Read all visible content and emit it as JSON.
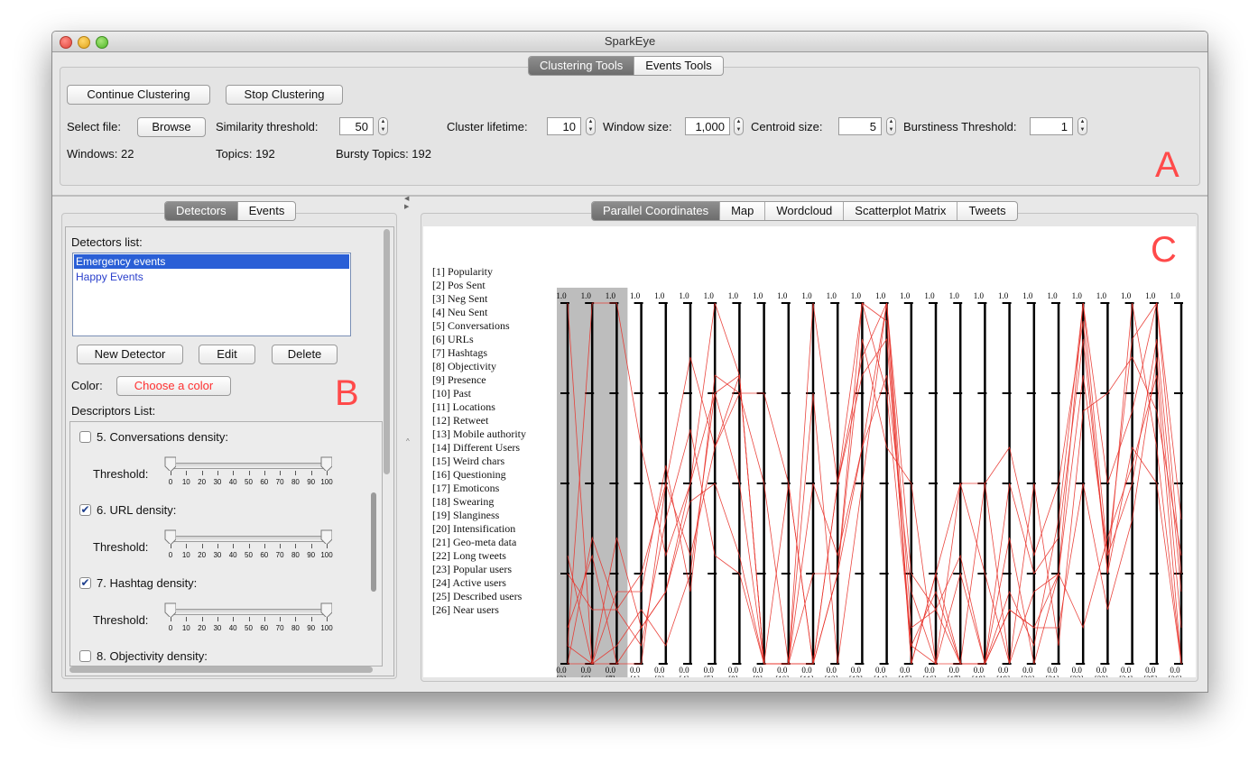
{
  "window": {
    "title": "SparkEye"
  },
  "top_tabs": [
    "Clustering Tools",
    "Events Tools"
  ],
  "clustering": {
    "continue_label": "Continue Clustering",
    "stop_label": "Stop Clustering",
    "select_file_label": "Select file:",
    "browse_label": "Browse",
    "similarity_label": "Similarity threshold:",
    "similarity_value": "50",
    "cluster_lifetime_label": "Cluster lifetime:",
    "cluster_lifetime_value": "10",
    "window_size_label": "Window size:",
    "window_size_value": "1,000",
    "centroid_size_label": "Centroid size:",
    "centroid_size_value": "5",
    "burstiness_label": "Burstiness Threshold:",
    "burstiness_value": "1",
    "windows_text": "Windows: 22",
    "topics_text": "Topics: 192",
    "bursty_text": "Bursty Topics: 192"
  },
  "annotations": {
    "a": "A",
    "b": "B",
    "c": "C"
  },
  "left_tabs": [
    "Detectors",
    "Events"
  ],
  "detectors": {
    "list_label": "Detectors list:",
    "items": [
      "Emergency events",
      "Happy Events"
    ],
    "new_label": "New Detector",
    "edit_label": "Edit",
    "delete_label": "Delete",
    "color_label": "Color:",
    "choose_color_label": "Choose a color",
    "descriptors_label": "Descriptors List:",
    "threshold_label": "Threshold:",
    "scale_ticks": [
      "0",
      "10",
      "20",
      "30",
      "40",
      "50",
      "60",
      "70",
      "80",
      "90",
      "100"
    ],
    "descriptors": [
      {
        "label": "5. Conversations density:",
        "checked": false
      },
      {
        "label": "6. URL density:",
        "checked": true
      },
      {
        "label": "7. Hashtag density:",
        "checked": true
      },
      {
        "label": "8. Objectivity density:",
        "checked": false
      }
    ]
  },
  "right_tabs": [
    "Parallel Coordinates",
    "Map",
    "Wordcloud",
    "Scatterplot Matrix",
    "Tweets"
  ],
  "legend": [
    "[1] Popularity",
    "[2] Pos Sent",
    "[3] Neg Sent",
    "[4] Neu Sent",
    "[5] Conversations",
    "[6] URLs",
    "[7] Hashtags",
    "[8] Objectivity",
    "[9] Presence",
    "[10] Past",
    "[11] Locations",
    "[12] Retweet",
    "[13] Mobile authority",
    "[14] Different Users",
    "[15] Weird chars",
    "[16] Questioning",
    "[17] Emoticons",
    "[18] Swearing",
    "[19] Slanginess",
    "[20] Intensification",
    "[21] Geo-meta data",
    "[22] Long tweets",
    "[23] Popular users",
    "[24] Active users",
    "[25] Described users",
    "[26] Near users"
  ],
  "colors": {
    "line": "#e8322a",
    "accent_text": "#ff3030",
    "selection": "#2a5fd6",
    "highlight_band": "#bdbdbd"
  },
  "chart_data": {
    "type": "parallel-coordinates",
    "axis_order": [
      "[3]",
      "[6]",
      "[7]",
      "[1]",
      "[2]",
      "[4]",
      "[5]",
      "[8]",
      "[9]",
      "[10]",
      "[11]",
      "[12]",
      "[13]",
      "[14]",
      "[15]",
      "[16]",
      "[17]",
      "[18]",
      "[19]",
      "[20]",
      "[21]",
      "[22]",
      "[23]",
      "[24]",
      "[25]",
      "[26]"
    ],
    "highlighted_axes": [
      "[3]",
      "[6]",
      "[7]"
    ],
    "axis_max_label": "1.0",
    "axis_min_label": "0.0",
    "ylim": [
      0,
      1
    ],
    "series": [
      [
        0.05,
        1,
        1,
        0.6,
        0.3,
        0.5,
        1,
        0.8,
        0,
        0,
        0.5,
        0.3,
        0.6,
        1,
        0.25,
        0.15,
        0,
        0,
        0.2,
        0.05,
        0.4,
        1,
        0.5,
        0.7,
        1,
        0.4
      ],
      [
        1,
        0,
        0,
        0,
        0.5,
        0.85,
        0.6,
        0.75,
        0.5,
        0,
        1,
        0.5,
        0.8,
        0.9,
        0.05,
        0.2,
        0,
        0,
        0.35,
        0,
        0.25,
        0.8,
        0.3,
        0.5,
        0.9,
        0.2
      ],
      [
        0.1,
        0.3,
        0,
        0.1,
        0.2,
        0.5,
        0.75,
        0.5,
        0,
        0,
        0,
        0.5,
        0.85,
        1,
        0,
        0.25,
        0,
        0.5,
        0.6,
        0.3,
        0.5,
        0.95,
        0.25,
        1,
        0.6,
        0
      ],
      [
        0,
        0,
        0.2,
        0.2,
        0.55,
        0.2,
        0.8,
        0.75,
        0.75,
        0.5,
        0,
        0.25,
        0.9,
        0.6,
        0.5,
        0,
        0.5,
        0.25,
        0,
        0.5,
        0.05,
        0.7,
        0.75,
        0.85,
        0.7,
        0.3
      ],
      [
        0.25,
        0.15,
        0.15,
        0.05,
        0.4,
        0.65,
        0.3,
        0.25,
        0,
        0,
        0.75,
        0,
        0.5,
        1,
        0.1,
        0.15,
        0.3,
        0,
        0.15,
        0.1,
        0.25,
        0.1,
        0.35,
        0.55,
        0.8,
        0
      ],
      [
        0.05,
        0,
        0.05,
        0.15,
        0.05,
        0.25,
        0.75,
        0.8,
        0,
        0.5,
        0,
        0.5,
        1,
        0.95,
        0,
        0.25,
        0.5,
        0.5,
        0,
        0.2,
        0.25,
        1,
        0.3,
        0.9,
        1,
        0.25
      ],
      [
        0.3,
        0,
        0.35,
        0.1,
        0.2,
        0.45,
        0.5,
        0.3,
        0,
        0,
        0.25,
        0.25,
        0.6,
        0.8,
        0.2,
        0,
        0.25,
        0,
        0.5,
        0.25,
        0.35,
        0.9,
        0.25,
        0.6,
        0.5,
        0
      ],
      [
        0,
        0.35,
        0.15,
        0.25,
        0.5,
        0.3,
        0.6,
        0.8,
        0,
        0,
        0,
        0.25,
        1,
        0.75,
        0.05,
        0,
        0,
        0,
        0.15,
        0.1,
        0.1,
        0.5,
        0.15,
        0.4,
        0.85,
        0.1
      ]
    ]
  }
}
